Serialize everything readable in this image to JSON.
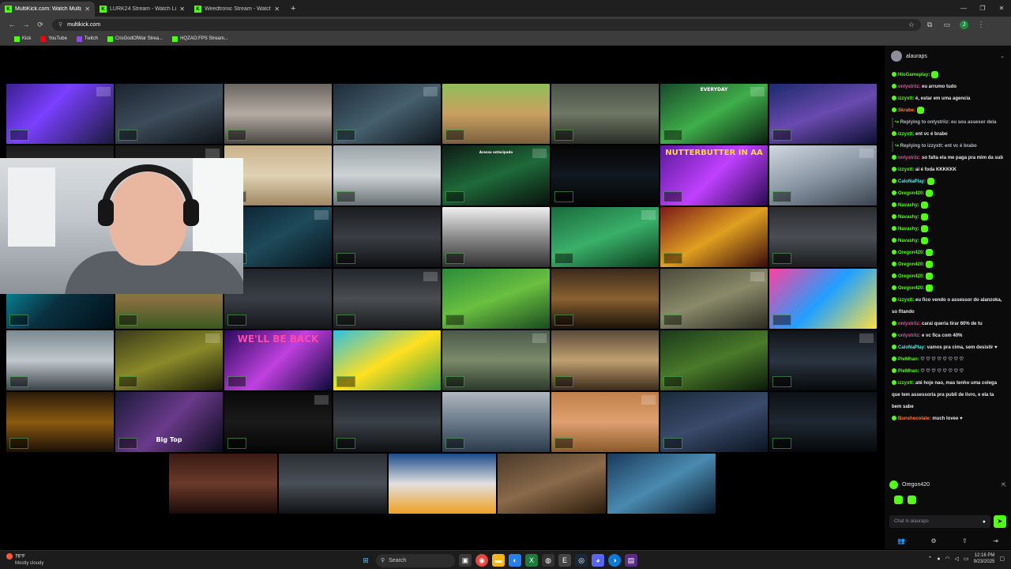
{
  "browser": {
    "tabs": [
      {
        "label": "MultiKick.com: Watch Multiple",
        "active": true
      },
      {
        "label": "LURK24 Stream - Watch Live o",
        "active": false
      },
      {
        "label": "Weedtronic Stream - Watch Liv",
        "active": false
      }
    ],
    "new_tab": "+",
    "url": "multikick.com",
    "bookmarks": [
      "Kick",
      "YouTube",
      "Twitch",
      "CrisGodOfWar Strea...",
      "HQZAO:FPS Stream..."
    ],
    "window_controls": [
      "—",
      "❐",
      "✕"
    ],
    "nav": [
      "←",
      "→",
      "⟳"
    ],
    "profile_initial": "J"
  },
  "grid": {
    "overlay_texts": {
      "back": "BACK",
      "well_be_back": "WE'LL BE BACK",
      "nutterbutter": "NUTTERBUTTER IN AA",
      "everyday": "EVERYDAY",
      "acesso": "Acesso antecipado",
      "big_top": "Big Top"
    }
  },
  "chat": {
    "channel": "alauraps",
    "messages": [
      {
        "user": "HioGameplay:",
        "text": "",
        "color": "green",
        "emote": true
      },
      {
        "user": "onlystriiz:",
        "text": "eu arrumo tudo",
        "color": "pink"
      },
      {
        "user": "izzyxtt:",
        "text": "é, estar em uma agencia",
        "color": "green"
      },
      {
        "user": "Skrabe:",
        "text": "",
        "color": "orange",
        "emote": true
      },
      {
        "reply": "Replying to onlystriiz: eu sou assesor dela"
      },
      {
        "user": "izzyxtt:",
        "text": "ent vc é brabo",
        "color": "green"
      },
      {
        "reply": "Replying to izzyxtt: ent vc é brabo"
      },
      {
        "user": "onlystriiz:",
        "text": "so falta ela me paga pra mim da sub",
        "color": "pink"
      },
      {
        "user": "izzyxtt:",
        "text": "ai é foda KKKKKK",
        "color": "green"
      },
      {
        "user": "CaloNaPlay:",
        "text": "",
        "color": "cyan",
        "emote": true
      },
      {
        "user": "Oregon420:",
        "text": "",
        "color": "green",
        "emote": true
      },
      {
        "user": "Navashy:",
        "text": "",
        "color": "green",
        "emote": true
      },
      {
        "user": "Navashy:",
        "text": "",
        "color": "green",
        "emote": true
      },
      {
        "user": "Navashy:",
        "text": "",
        "color": "green",
        "emote": true
      },
      {
        "user": "Navashy:",
        "text": "",
        "color": "green",
        "emote": true
      },
      {
        "user": "Oregon420:",
        "text": "",
        "color": "green",
        "emote": true
      },
      {
        "user": "Oregon420:",
        "text": "",
        "color": "green",
        "emote": true
      },
      {
        "user": "Oregon420:",
        "text": "",
        "color": "green",
        "emote": true
      },
      {
        "user": "Oregon420:",
        "text": "",
        "color": "green",
        "emote": true
      },
      {
        "user": "izzyxtt:",
        "text": "eu fico vendo o assessor do alanzoka, so fitando",
        "color": "green"
      },
      {
        "user": "onlystriiz:",
        "text": "carai queria tirar 60% de tu",
        "color": "pink"
      },
      {
        "user": "onlystriiz:",
        "text": "e vc fica com 40%",
        "color": "pink"
      },
      {
        "user": "CaloNaPlay:",
        "text": "vamos pra cima, sem desistir ♥",
        "color": "cyan"
      },
      {
        "user": "PieMhan:",
        "text": "♡ ♡ ♡ ♡ ♡ ♡ ♡ ♡",
        "color": "green"
      },
      {
        "user": "PieMhan:",
        "text": "♡ ♡ ♡ ♡ ♡ ♡ ♡ ♡",
        "color": "green"
      },
      {
        "user": "izzyxtt:",
        "text": "até hoje nao, mas tenho uma colega que tem assessoria pra publi de livro, e ela ta bem sabe",
        "color": "green"
      },
      {
        "user": "Bunshocolate:",
        "text": "much lovee ♥",
        "color": "orange"
      }
    ],
    "pinned_user": "Oregon420",
    "input_placeholder": "Chat in alauraps",
    "send_icon": "➤",
    "footer_icons": [
      "👥",
      "⚙",
      "⇪",
      "⇥"
    ]
  },
  "taskbar": {
    "temperature": "76°F",
    "condition": "Mostly cloudy",
    "search_placeholder": "Search",
    "time": "12:16 PM",
    "date": "9/23/2025"
  }
}
